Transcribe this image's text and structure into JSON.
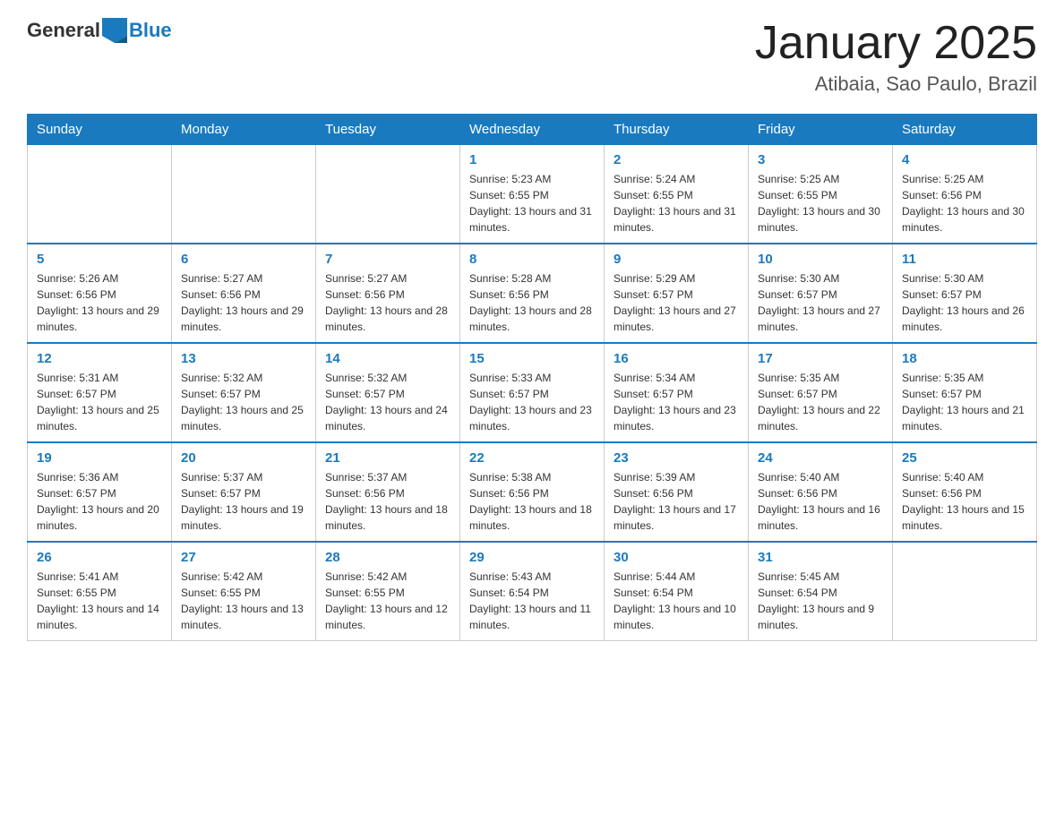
{
  "header": {
    "logo_text_general": "General",
    "logo_text_blue": "Blue",
    "month_year": "January 2025",
    "location": "Atibaia, Sao Paulo, Brazil"
  },
  "days_of_week": [
    "Sunday",
    "Monday",
    "Tuesday",
    "Wednesday",
    "Thursday",
    "Friday",
    "Saturday"
  ],
  "weeks": [
    [
      {
        "day": "",
        "info": ""
      },
      {
        "day": "",
        "info": ""
      },
      {
        "day": "",
        "info": ""
      },
      {
        "day": "1",
        "info": "Sunrise: 5:23 AM\nSunset: 6:55 PM\nDaylight: 13 hours and 31 minutes."
      },
      {
        "day": "2",
        "info": "Sunrise: 5:24 AM\nSunset: 6:55 PM\nDaylight: 13 hours and 31 minutes."
      },
      {
        "day": "3",
        "info": "Sunrise: 5:25 AM\nSunset: 6:55 PM\nDaylight: 13 hours and 30 minutes."
      },
      {
        "day": "4",
        "info": "Sunrise: 5:25 AM\nSunset: 6:56 PM\nDaylight: 13 hours and 30 minutes."
      }
    ],
    [
      {
        "day": "5",
        "info": "Sunrise: 5:26 AM\nSunset: 6:56 PM\nDaylight: 13 hours and 29 minutes."
      },
      {
        "day": "6",
        "info": "Sunrise: 5:27 AM\nSunset: 6:56 PM\nDaylight: 13 hours and 29 minutes."
      },
      {
        "day": "7",
        "info": "Sunrise: 5:27 AM\nSunset: 6:56 PM\nDaylight: 13 hours and 28 minutes."
      },
      {
        "day": "8",
        "info": "Sunrise: 5:28 AM\nSunset: 6:56 PM\nDaylight: 13 hours and 28 minutes."
      },
      {
        "day": "9",
        "info": "Sunrise: 5:29 AM\nSunset: 6:57 PM\nDaylight: 13 hours and 27 minutes."
      },
      {
        "day": "10",
        "info": "Sunrise: 5:30 AM\nSunset: 6:57 PM\nDaylight: 13 hours and 27 minutes."
      },
      {
        "day": "11",
        "info": "Sunrise: 5:30 AM\nSunset: 6:57 PM\nDaylight: 13 hours and 26 minutes."
      }
    ],
    [
      {
        "day": "12",
        "info": "Sunrise: 5:31 AM\nSunset: 6:57 PM\nDaylight: 13 hours and 25 minutes."
      },
      {
        "day": "13",
        "info": "Sunrise: 5:32 AM\nSunset: 6:57 PM\nDaylight: 13 hours and 25 minutes."
      },
      {
        "day": "14",
        "info": "Sunrise: 5:32 AM\nSunset: 6:57 PM\nDaylight: 13 hours and 24 minutes."
      },
      {
        "day": "15",
        "info": "Sunrise: 5:33 AM\nSunset: 6:57 PM\nDaylight: 13 hours and 23 minutes."
      },
      {
        "day": "16",
        "info": "Sunrise: 5:34 AM\nSunset: 6:57 PM\nDaylight: 13 hours and 23 minutes."
      },
      {
        "day": "17",
        "info": "Sunrise: 5:35 AM\nSunset: 6:57 PM\nDaylight: 13 hours and 22 minutes."
      },
      {
        "day": "18",
        "info": "Sunrise: 5:35 AM\nSunset: 6:57 PM\nDaylight: 13 hours and 21 minutes."
      }
    ],
    [
      {
        "day": "19",
        "info": "Sunrise: 5:36 AM\nSunset: 6:57 PM\nDaylight: 13 hours and 20 minutes."
      },
      {
        "day": "20",
        "info": "Sunrise: 5:37 AM\nSunset: 6:57 PM\nDaylight: 13 hours and 19 minutes."
      },
      {
        "day": "21",
        "info": "Sunrise: 5:37 AM\nSunset: 6:56 PM\nDaylight: 13 hours and 18 minutes."
      },
      {
        "day": "22",
        "info": "Sunrise: 5:38 AM\nSunset: 6:56 PM\nDaylight: 13 hours and 18 minutes."
      },
      {
        "day": "23",
        "info": "Sunrise: 5:39 AM\nSunset: 6:56 PM\nDaylight: 13 hours and 17 minutes."
      },
      {
        "day": "24",
        "info": "Sunrise: 5:40 AM\nSunset: 6:56 PM\nDaylight: 13 hours and 16 minutes."
      },
      {
        "day": "25",
        "info": "Sunrise: 5:40 AM\nSunset: 6:56 PM\nDaylight: 13 hours and 15 minutes."
      }
    ],
    [
      {
        "day": "26",
        "info": "Sunrise: 5:41 AM\nSunset: 6:55 PM\nDaylight: 13 hours and 14 minutes."
      },
      {
        "day": "27",
        "info": "Sunrise: 5:42 AM\nSunset: 6:55 PM\nDaylight: 13 hours and 13 minutes."
      },
      {
        "day": "28",
        "info": "Sunrise: 5:42 AM\nSunset: 6:55 PM\nDaylight: 13 hours and 12 minutes."
      },
      {
        "day": "29",
        "info": "Sunrise: 5:43 AM\nSunset: 6:54 PM\nDaylight: 13 hours and 11 minutes."
      },
      {
        "day": "30",
        "info": "Sunrise: 5:44 AM\nSunset: 6:54 PM\nDaylight: 13 hours and 10 minutes."
      },
      {
        "day": "31",
        "info": "Sunrise: 5:45 AM\nSunset: 6:54 PM\nDaylight: 13 hours and 9 minutes."
      },
      {
        "day": "",
        "info": ""
      }
    ]
  ]
}
